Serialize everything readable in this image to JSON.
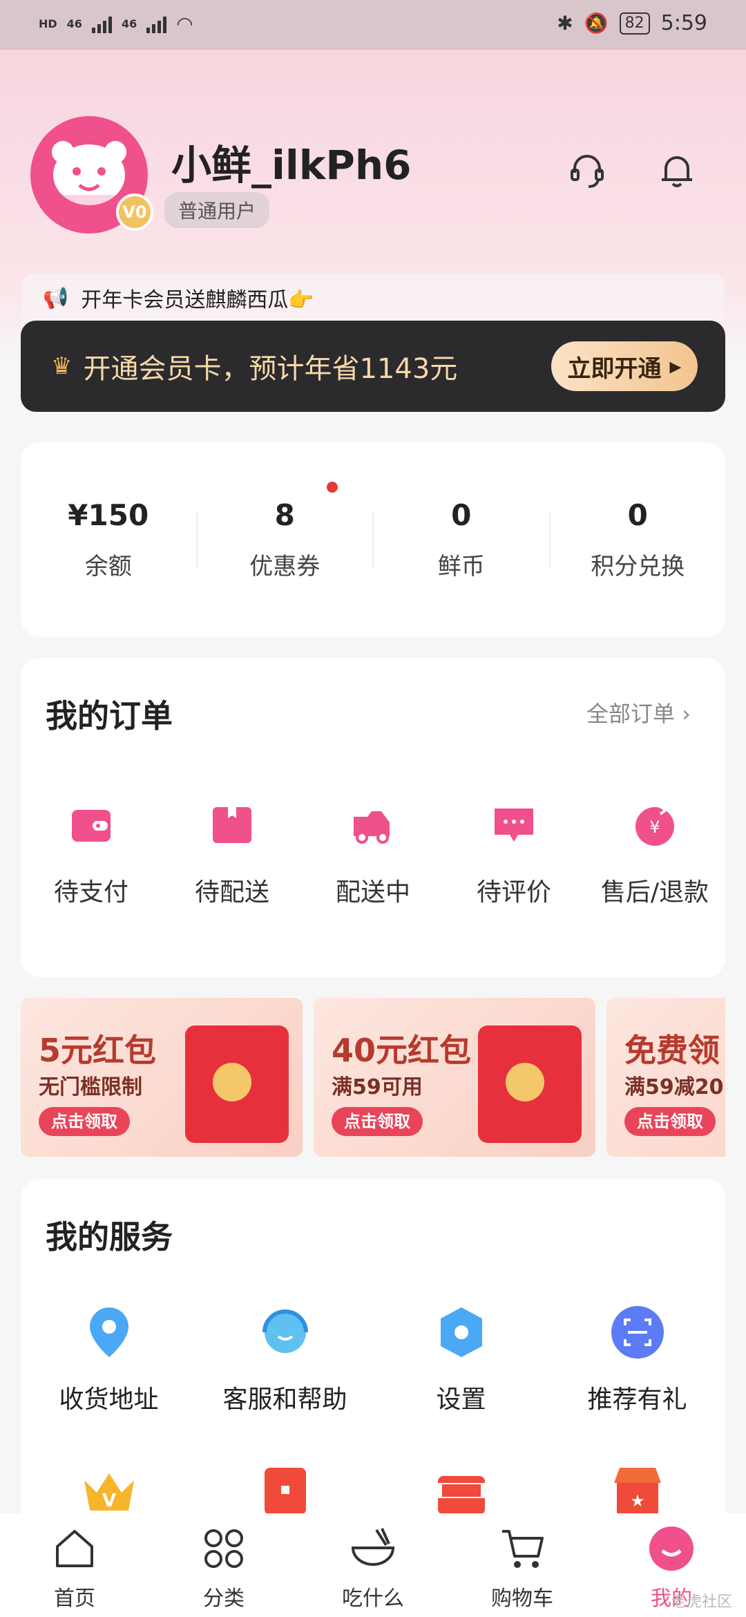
{
  "status_bar": {
    "net1": "HD",
    "net2": "46",
    "net3": "46",
    "battery": "82",
    "time": "5:59"
  },
  "header": {
    "username": "小鲜_ilkPh6",
    "user_tag": "普通用户",
    "vip_level": "V0"
  },
  "notice": {
    "text": "开年卡会员送麒麟西瓜👉"
  },
  "vip_bar": {
    "text": "开通会员卡，预计年省1143元",
    "button": "立即开通"
  },
  "stats": [
    {
      "value": "¥150",
      "label": "余额"
    },
    {
      "value": "8",
      "label": "优惠券"
    },
    {
      "value": "0",
      "label": "鲜币"
    },
    {
      "value": "0",
      "label": "积分兑换"
    }
  ],
  "orders": {
    "title": "我的订单",
    "all_link": "全部订单",
    "items": [
      {
        "label": "待支付",
        "icon": "wallet-icon"
      },
      {
        "label": "待配送",
        "icon": "box-icon"
      },
      {
        "label": "配送中",
        "icon": "truck-icon"
      },
      {
        "label": "待评价",
        "icon": "comment-icon"
      },
      {
        "label": "售后/退款",
        "icon": "refund-icon"
      }
    ]
  },
  "promos": [
    {
      "title": "5元红包",
      "subtitle": "无门槛限制",
      "button": "点击领取"
    },
    {
      "title": "40元红包",
      "subtitle": "满59可用",
      "button": "点击领取"
    },
    {
      "title": "免费领",
      "subtitle": "满59减20",
      "button": "点击领取"
    }
  ],
  "services": {
    "title": "我的服务",
    "items": [
      {
        "label": "收货地址",
        "icon": "location-icon"
      },
      {
        "label": "客服和帮助",
        "icon": "support-icon"
      },
      {
        "label": "设置",
        "icon": "settings-icon"
      },
      {
        "label": "推荐有礼",
        "icon": "scan-icon"
      }
    ]
  },
  "tabs": [
    {
      "label": "首页",
      "icon": "home-icon"
    },
    {
      "label": "分类",
      "icon": "grid-icon"
    },
    {
      "label": "吃什么",
      "icon": "bowl-icon"
    },
    {
      "label": "购物车",
      "icon": "cart-icon"
    },
    {
      "label": "我的",
      "icon": "profile-icon"
    }
  ],
  "watermark": "老虎社区",
  "colors": {
    "brand": "#f0508c",
    "vip_bg": "#2b2a2d",
    "vip_gold": "#f2c48f"
  }
}
